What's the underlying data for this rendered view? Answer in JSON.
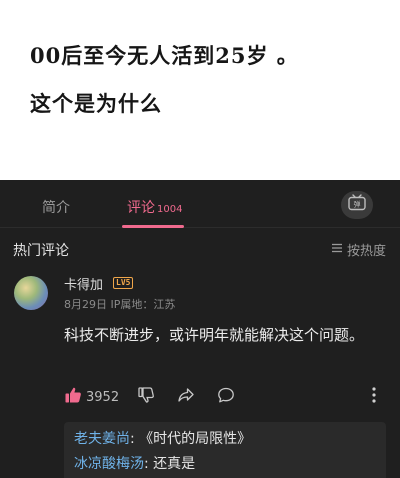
{
  "caption": {
    "line1": "00后至今无人活到25岁 。",
    "line2": "这个是为什么"
  },
  "tabs": [
    {
      "label": "简介",
      "count": ""
    },
    {
      "label": "评论",
      "count": "1004"
    }
  ],
  "section": {
    "title": "热门评论",
    "sort_label": "按热度"
  },
  "comment": {
    "username": "卡得加",
    "level": "LV5",
    "meta": "8月29日  IP属地：江苏",
    "text": "科技不断进步，或许明年就能解决这个问题。",
    "likes": "3952"
  },
  "replies": [
    {
      "user": "老夫姜尚",
      "sep": ": ",
      "text": "《时代的局限性》"
    },
    {
      "user": "冰凉酸梅汤",
      "sep": ": ",
      "text": "还真是"
    },
    {
      "user": "",
      "sep": "",
      "text": ""
    }
  ],
  "colors": {
    "accent_pink": "#f06a8e",
    "reply_user_blue": "#6fb2e8",
    "level_badge": "#f0a64a",
    "background": "#1f1f1f"
  },
  "icons": [
    "tv-danmaku-icon",
    "sort-icon",
    "thumbs-up-icon",
    "thumbs-down-icon",
    "share-icon",
    "reply-icon",
    "more-icon"
  ]
}
